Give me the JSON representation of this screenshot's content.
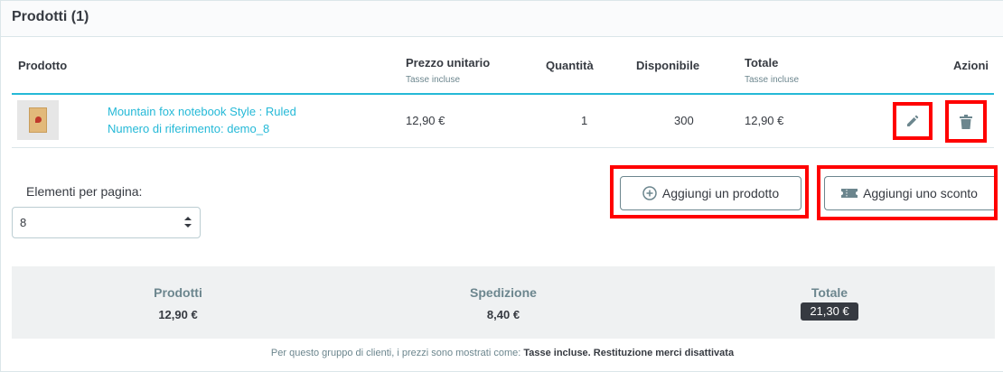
{
  "card": {
    "title": "Prodotti (1)"
  },
  "table": {
    "headers": {
      "product": "Prodotto",
      "unit_price": "Prezzo unitario",
      "unit_price_sub": "Tasse incluse",
      "quantity": "Quantità",
      "available": "Disponibile",
      "total": "Totale",
      "total_sub": "Tasse incluse",
      "actions": "Azioni"
    },
    "rows": [
      {
        "name": "Mountain fox notebook Style : Ruled",
        "reference": "Numero di riferimento: demo_8",
        "unit_price": "12,90 €",
        "quantity": "1",
        "available": "300",
        "total": "12,90 €",
        "thumbnail_icon": "notebook-thumbnail"
      }
    ],
    "row_actions": {
      "edit_icon": "pencil-icon",
      "delete_icon": "trash-icon"
    }
  },
  "pagination": {
    "label": "Elementi per pagina:",
    "selected": "8"
  },
  "buttons": {
    "add_product": "Aggiungi un prodotto",
    "add_product_icon": "plus-circle-icon",
    "add_discount": "Aggiungi uno sconto",
    "add_discount_icon": "ticket-icon"
  },
  "summary": {
    "products_label": "Prodotti",
    "products_value": "12,90 €",
    "shipping_label": "Spedizione",
    "shipping_value": "8,40 €",
    "total_label": "Totale",
    "total_value": "21,30 €"
  },
  "footer": {
    "prefix": "Per questo gruppo di clienti, i prezzi sono mostrati come:",
    "tax_mode": "Tasse incluse.",
    "returns": "Restituzione merci disattivata"
  },
  "colors": {
    "accent": "#25b9d7",
    "highlight_box": "#ff0000",
    "summary_bg": "#eff1f2",
    "total_badge": "#363a41"
  }
}
